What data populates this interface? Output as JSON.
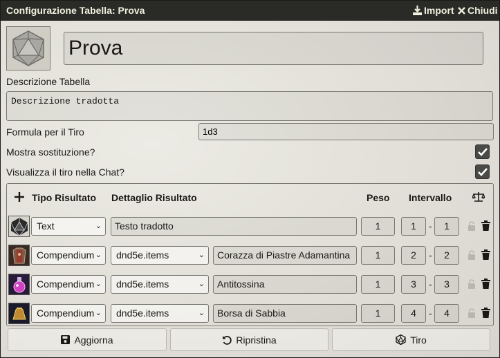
{
  "window": {
    "title": "Configurazione Tabella: Prova",
    "import_label": "Import",
    "close_label": "Chiudi"
  },
  "table": {
    "name": "Prova",
    "description_label": "Descrizione Tabella",
    "description": "Descrizione tradotta",
    "formula_label": "Formula per il Tiro",
    "formula": "1d3",
    "show_replacement_label": "Mostra sostituzione?",
    "show_replacement": true,
    "display_roll_label": "Visualizza il tiro nella Chat?",
    "display_roll": true
  },
  "results_header": {
    "type": "Tipo Risultato",
    "detail": "Dettaglio Risultato",
    "weight": "Peso",
    "range": "Intervallo"
  },
  "results": [
    {
      "icon": "d20-icon",
      "type": "Text",
      "text": "Testo tradotto",
      "weight": "1",
      "range_low": "1",
      "range_high": "1"
    },
    {
      "icon": "armor-icon",
      "type": "Compendium",
      "collection": "dnd5e.items",
      "text": "Corazza di Piastre Adamantina",
      "weight": "1",
      "range_low": "2",
      "range_high": "2"
    },
    {
      "icon": "potion-icon",
      "type": "Compendium",
      "collection": "dnd5e.items",
      "text": "Antitossina",
      "weight": "1",
      "range_low": "3",
      "range_high": "3"
    },
    {
      "icon": "sand-pouch-icon",
      "type": "Compendium",
      "collection": "dnd5e.items",
      "text": "Borsa di Sabbia",
      "weight": "1",
      "range_low": "4",
      "range_high": "4"
    }
  ],
  "footer": {
    "update_label": "Aggiorna",
    "reset_label": "Ripristina",
    "roll_label": "Tiro"
  },
  "colors": {
    "titlebar": "#2a2a26",
    "background": "#e4e2da",
    "checkbox": "#4a4a46"
  }
}
